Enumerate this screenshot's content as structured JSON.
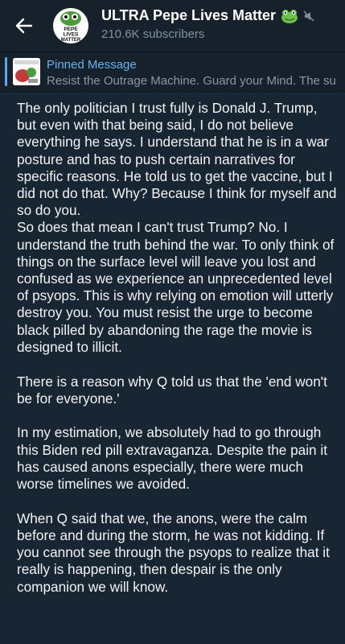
{
  "header": {
    "title": "ULTRA Pepe Lives Matter",
    "subtitle": "210.6K subscribers",
    "avatar_text": [
      "PEPE",
      "LIVES",
      "MATTER"
    ]
  },
  "pinned": {
    "label": "Pinned Message",
    "text": "Resist the Outrage Machine.  Guard your Mind.   The su"
  },
  "message": {
    "paragraphs": [
      "The only politician I trust fully is Donald J. Trump, but even with that being said, I do not believe everything he says. I understand that he is in a war posture and has to push certain narratives for specific reasons. He told us to get the vaccine, but I did not do that. Why? Because I think for myself and so do you.\nSo does that mean I can't trust Trump? No. I understand the truth behind the war. To only think of things on the surface level will leave you lost and confused as we experience an unprecedented level of psyops. This is why relying on emotion will utterly destroy you. You must resist the urge to become black pilled by abandoning the rage the movie is designed to illicit.",
      "There is a reason why Q told us that the 'end won't be for everyone.'",
      "In my estimation, we absolutely had to go through this Biden red pill extravaganza. Despite the pain it has caused anons especially, there were much worse timelines we avoided.",
      "When Q said that we, the anons, were the calm before and during the storm, he was not kidding. If you cannot see through the psyops to realize that it really is happening, then despair is the only companion we will know."
    ]
  },
  "colors": {
    "background": "#0e1621",
    "header_bg": "#17212b",
    "message_bg": "#182533",
    "accent": "#6ab2f2"
  },
  "icons": [
    "back-arrow-icon",
    "frog-emoji-icon",
    "muted-icon",
    "pepe-avatar",
    "pinned-thumbnail"
  ]
}
